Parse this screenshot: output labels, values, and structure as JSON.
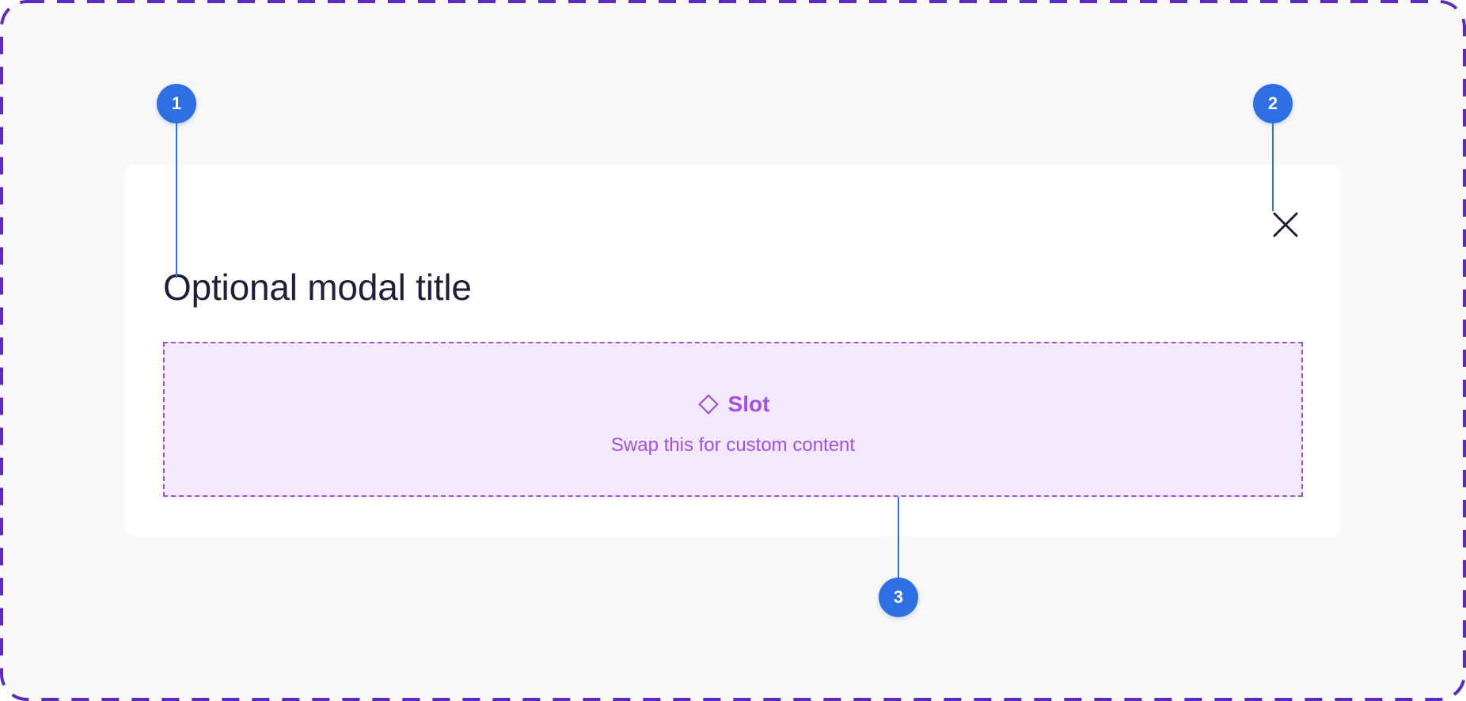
{
  "modal": {
    "title": "Optional modal title",
    "close_icon": "close-icon"
  },
  "slot": {
    "icon": "diamond-icon",
    "label": "Slot",
    "description": "Swap this for custom content"
  },
  "annotations": [
    "1",
    "2",
    "3"
  ],
  "colors": {
    "frame_border": "#5b2bbf",
    "frame_background": "#f8f8f8",
    "modal_background": "#ffffff",
    "title_text": "#1e1f3a",
    "slot_accent": "#a54ee6",
    "slot_background": "#f2eafc",
    "annotation_blue": "#2f6fe4"
  }
}
